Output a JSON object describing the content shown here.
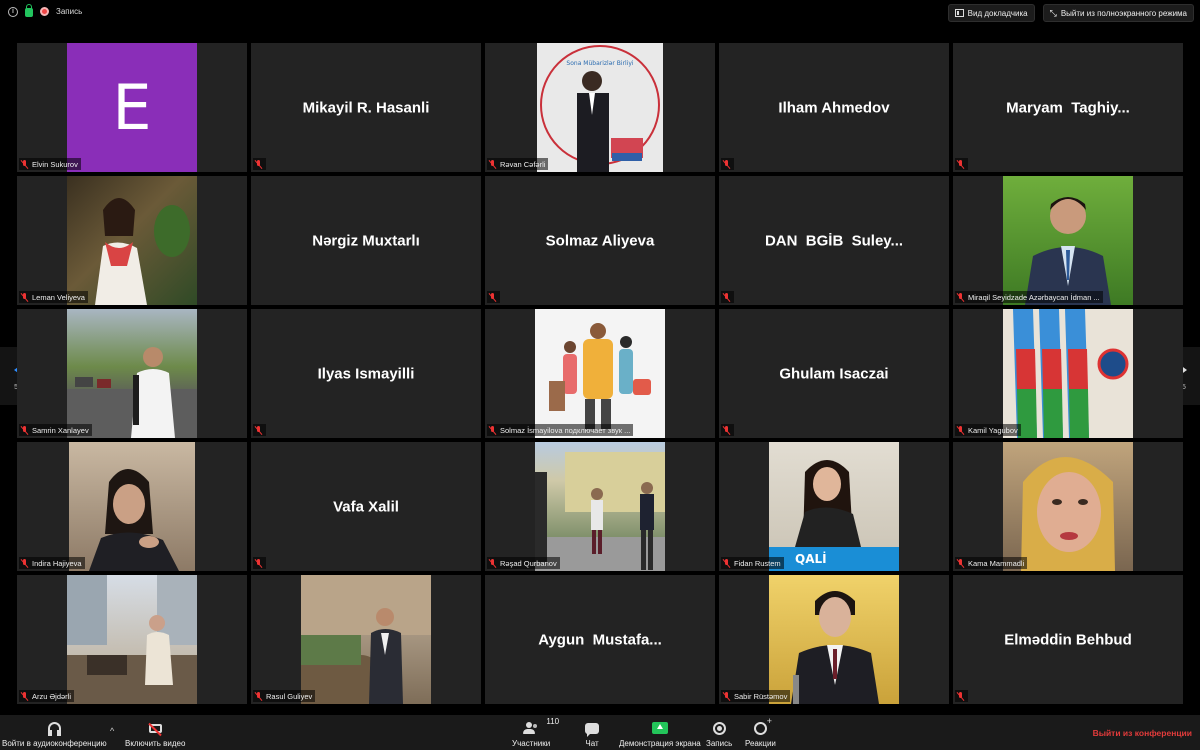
{
  "top_bar": {
    "recording_label": "Запись",
    "speaker_view_label": "Вид докладчика",
    "exit_fullscreen_label": "Выйти из полноэкранного режима"
  },
  "pagination": {
    "left": "5/5",
    "right": "5/5"
  },
  "participants": [
    {
      "label": "Elvin Sukurov",
      "kind": "avatar",
      "avatar_letter": "E",
      "avatar_color": "#8a2eb8"
    },
    {
      "label": "",
      "kind": "name",
      "display_name": "Mikayil R. Hasanli"
    },
    {
      "label": "Rəvan Cəfərli",
      "kind": "photo",
      "photo_text": "Sona Mübarizlər Birliyi"
    },
    {
      "label": "",
      "kind": "name",
      "display_name": "Ilham Ahmedov"
    },
    {
      "label": "",
      "kind": "name",
      "display_name": "Maryam  Taghiy..."
    },
    {
      "label": "Leman Veliyeva",
      "kind": "photo"
    },
    {
      "label": "",
      "kind": "name",
      "display_name": "Nərgiz Muxtarlı"
    },
    {
      "label": "",
      "kind": "name",
      "display_name": "Solmaz Aliyeva"
    },
    {
      "label": "",
      "kind": "name",
      "display_name": "DAN  BGİB  Suley..."
    },
    {
      "label": "Miraqil Seyidzade Azərbaycan İdman ...",
      "kind": "photo"
    },
    {
      "label": "Samrin Xanlayev",
      "kind": "photo"
    },
    {
      "label": "",
      "kind": "name",
      "display_name": "Ilyas Ismayilli"
    },
    {
      "label": "Solmaz İsmayilova подключает звук ...",
      "kind": "photo"
    },
    {
      "label": "",
      "kind": "name",
      "display_name": "Ghulam Isaczai"
    },
    {
      "label": "Kamil Yagubov",
      "kind": "photo"
    },
    {
      "label": "Indira Hajiyeva",
      "kind": "photo"
    },
    {
      "label": "",
      "kind": "name",
      "display_name": "Vafa Xalil"
    },
    {
      "label": "Rəşad Qurbanov",
      "kind": "photo"
    },
    {
      "label": "Fidan Rustem",
      "kind": "photo",
      "photo_text": "QALİ"
    },
    {
      "label": "Kama Mammadli",
      "kind": "photo"
    },
    {
      "label": "Arzu Əjdərli",
      "kind": "photo"
    },
    {
      "label": "Rasul Guliyev",
      "kind": "photo"
    },
    {
      "label": "",
      "kind": "name",
      "display_name": "Aygun  Mustafa..."
    },
    {
      "label": "Sabir Rüstəmov",
      "kind": "photo"
    },
    {
      "label": "",
      "kind": "name",
      "display_name": "Elməddin Behbud"
    }
  ],
  "toolbar": {
    "audio_label": "Войти в аудиоконференцию",
    "video_label": "Включить видео",
    "participants_label": "Участники",
    "participants_count": "110",
    "chat_label": "Чат",
    "share_label": "Демонстрация экрана",
    "record_label": "Запись",
    "reactions_label": "Реакции",
    "leave_label": "Выйти из конференции"
  },
  "colors": {
    "accent": "#2d8cff",
    "leave": "#e23b3b",
    "share": "#23c55a",
    "muted": "#e33333"
  }
}
